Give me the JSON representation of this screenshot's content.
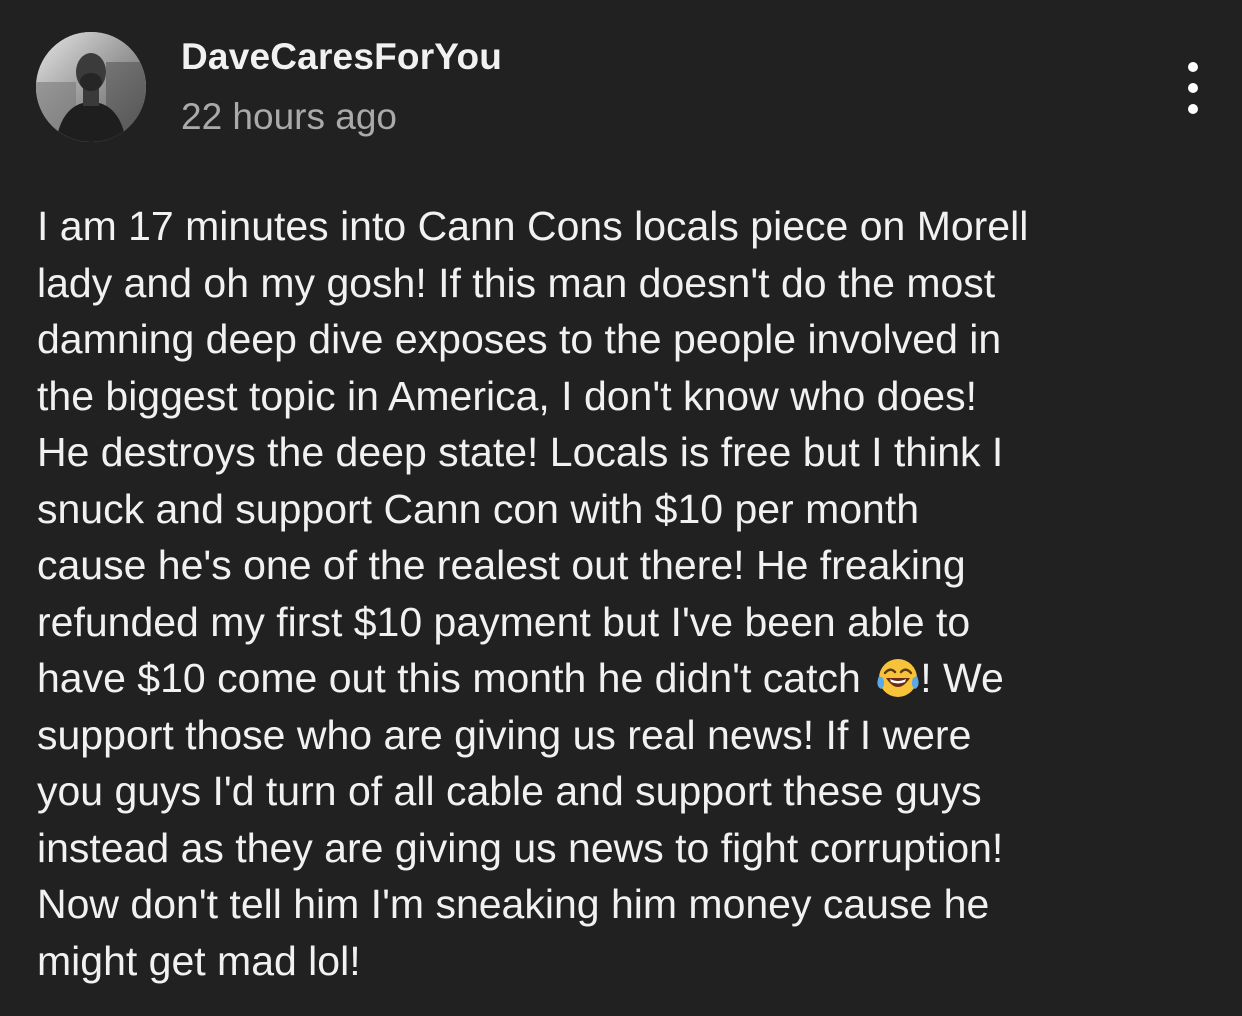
{
  "comment": {
    "author": "DaveCaresForYou",
    "timestamp": "22 hours ago",
    "avatar_icon": "user-photo-avatar",
    "more_icon": "vertical-ellipsis-icon",
    "body_lines": [
      "I am 17 minutes into Cann Cons locals piece on Morell",
      "lady and oh my gosh! If this man doesn't do the most",
      "damning deep dive exposes to the people involved in",
      "the biggest topic in America, I don't know who does!",
      "He destroys the deep state! Locals is free but I think I",
      "snuck and support Cann con with $10 per month",
      "cause he's one of the realest out there! He freaking",
      "refunded my first $10 payment but I've been able to",
      "have $10 come out this month he didn't catch",
      "! We",
      "support those who are giving us real news! If I were",
      "you guys I'd turn of all cable and support these guys",
      "instead as they are giving us news to fight corruption!",
      "Now don't tell him I'm sneaking him money cause he",
      "might get mad lol!"
    ],
    "emoji": "face-with-tears-of-joy-emoji"
  },
  "colors": {
    "background": "#212121",
    "author": "#f1f1f1",
    "timestamp": "#aaaaaa",
    "body": "#f1f1f1"
  }
}
